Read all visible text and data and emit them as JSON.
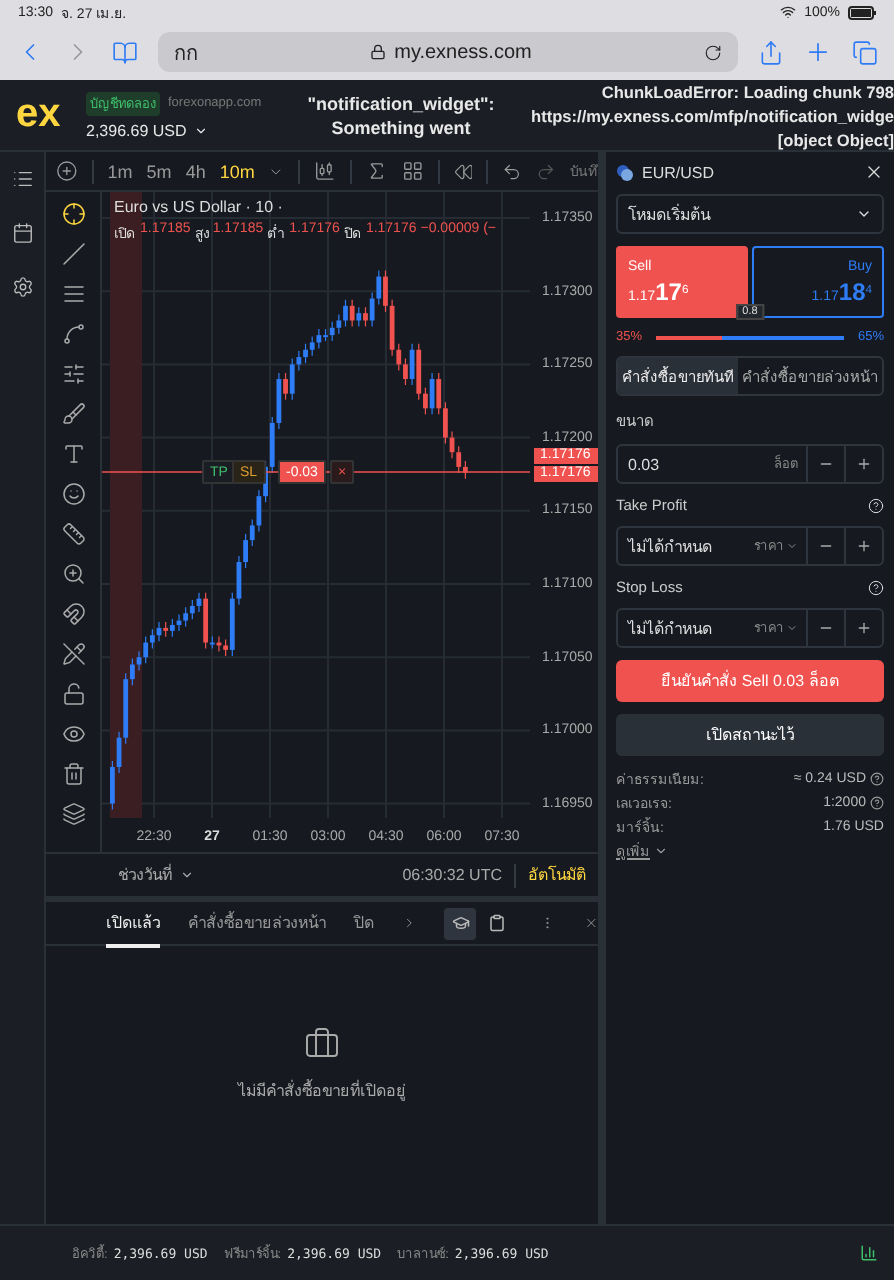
{
  "status_bar": {
    "time": "13:30",
    "date": "จ. 27 เม.ย.",
    "battery": "100%"
  },
  "browser": {
    "text_size": "กก",
    "url": "my.exness.com"
  },
  "header": {
    "logo": "ex",
    "account_badge": "บัญชีทดลอง",
    "domain": "forexonapp.com",
    "balance": "2,396.69 USD",
    "widget_error": [
      "\"notification_widget\":",
      "Something went"
    ],
    "chunk_error": [
      "ChunkLoadError: Loading chunk 798",
      "https://my.exness.com/mfp/notification_widge",
      "[object Object]"
    ]
  },
  "chart": {
    "timeframes": [
      {
        "label": "1m",
        "selected": false
      },
      {
        "label": "5m",
        "selected": false
      },
      {
        "label": "4h",
        "selected": false
      },
      {
        "label": "10m",
        "selected": true
      }
    ],
    "save_label": "บันทึ",
    "title": "Euro vs US Dollar · 10 ·",
    "ohlc": [
      {
        "label": "เปิด",
        "value": "1.17185"
      },
      {
        "label": "สูง",
        "value": "1.17185"
      },
      {
        "label": "ต่ำ",
        "value": "1.17176"
      },
      {
        "label": "ปิด",
        "value": "1.17176"
      }
    ],
    "change": "−0.00009 (−",
    "price_ticks": [
      "1.17350",
      "1.17300",
      "1.17250",
      "1.17200",
      "1.17150",
      "1.17100",
      "1.17050",
      "1.17000",
      "1.16950"
    ],
    "price_labels": [
      "1.17176",
      "1.17176"
    ],
    "time_ticks": [
      {
        "label": "22:30",
        "bold": false
      },
      {
        "label": "27",
        "bold": true
      },
      {
        "label": "01:30",
        "bold": false
      },
      {
        "label": "03:00",
        "bold": false
      },
      {
        "label": "04:30",
        "bold": false
      },
      {
        "label": "06:00",
        "bold": false
      },
      {
        "label": "07:30",
        "bold": false
      }
    ],
    "order_line": {
      "tp": "TP",
      "sl": "SL",
      "pnl": "-0.03",
      "close": "×"
    },
    "date_range": "ช่วงวันที่",
    "clock": "06:30:32 UTC",
    "auto_scale": "อัตโนมัติ"
  },
  "positions_panel": {
    "tabs": [
      {
        "label": "เปิดแล้ว",
        "selected": true
      },
      {
        "label": "คำสั่งซื้อขายล่วงหน้า",
        "selected": false
      },
      {
        "label": "ปิด",
        "selected": false
      }
    ],
    "view_toggles": [
      {
        "selected": true
      },
      {
        "selected": false
      }
    ],
    "empty_message": "ไม่มีคำสั่งซื้อขายที่เปิดอยู่"
  },
  "order_panel": {
    "symbol": "EUR/USD",
    "mode": "โหมดเริ่มต้น",
    "sides": [
      {
        "label": "Sell",
        "price_head": "1.17",
        "price_big": "17",
        "price_sup": "6",
        "selected": true,
        "color": "#f0524f"
      },
      {
        "label": "Buy",
        "price_head": "1.17",
        "price_big": "18",
        "price_sup": "4",
        "selected": false,
        "color": "#2e7cf6"
      }
    ],
    "spread": "0.8",
    "sell_share": "35%",
    "buy_share": "65%",
    "level": 0.35,
    "order_tabs": [
      {
        "label": "คำสั่งซื้อขายทันที",
        "selected": true
      },
      {
        "label": "คำสั่งซื้อขายล่วงหน้า",
        "selected": false
      }
    ],
    "volume": {
      "label": "ขนาด",
      "value": "0.03",
      "unit": "ล็อต"
    },
    "take_profit": {
      "label": "Take Profit",
      "value": "ไม่ได้กำหนด",
      "unit": "ราคา"
    },
    "stop_loss": {
      "label": "Stop Loss",
      "value": "ไม่ได้กำหนด",
      "unit": "ราคา"
    },
    "confirm": "ยืนยันคำสั่ง Sell 0.03 ล็อต",
    "cancel": "เปิดสถานะไว้",
    "info": [
      {
        "label": "ค่าธรรมเนียม:",
        "value": "≈ 0.24 USD",
        "help": true
      },
      {
        "label": "เลเวอเรจ:",
        "value": "1:2000",
        "help": true
      },
      {
        "label": "มาร์จิ้น:",
        "value": "1.76 USD",
        "help": false
      }
    ],
    "more": "ดูเพิ่ม"
  },
  "footer": {
    "stats": [
      {
        "label": "อิควิตี้:",
        "value": "2,396.69 USD"
      },
      {
        "label": "ฟรีมาร์จิ้น:",
        "value": "2,396.69 USD"
      },
      {
        "label": "บาลานซ์:",
        "value": "2,396.69 USD"
      }
    ]
  }
}
